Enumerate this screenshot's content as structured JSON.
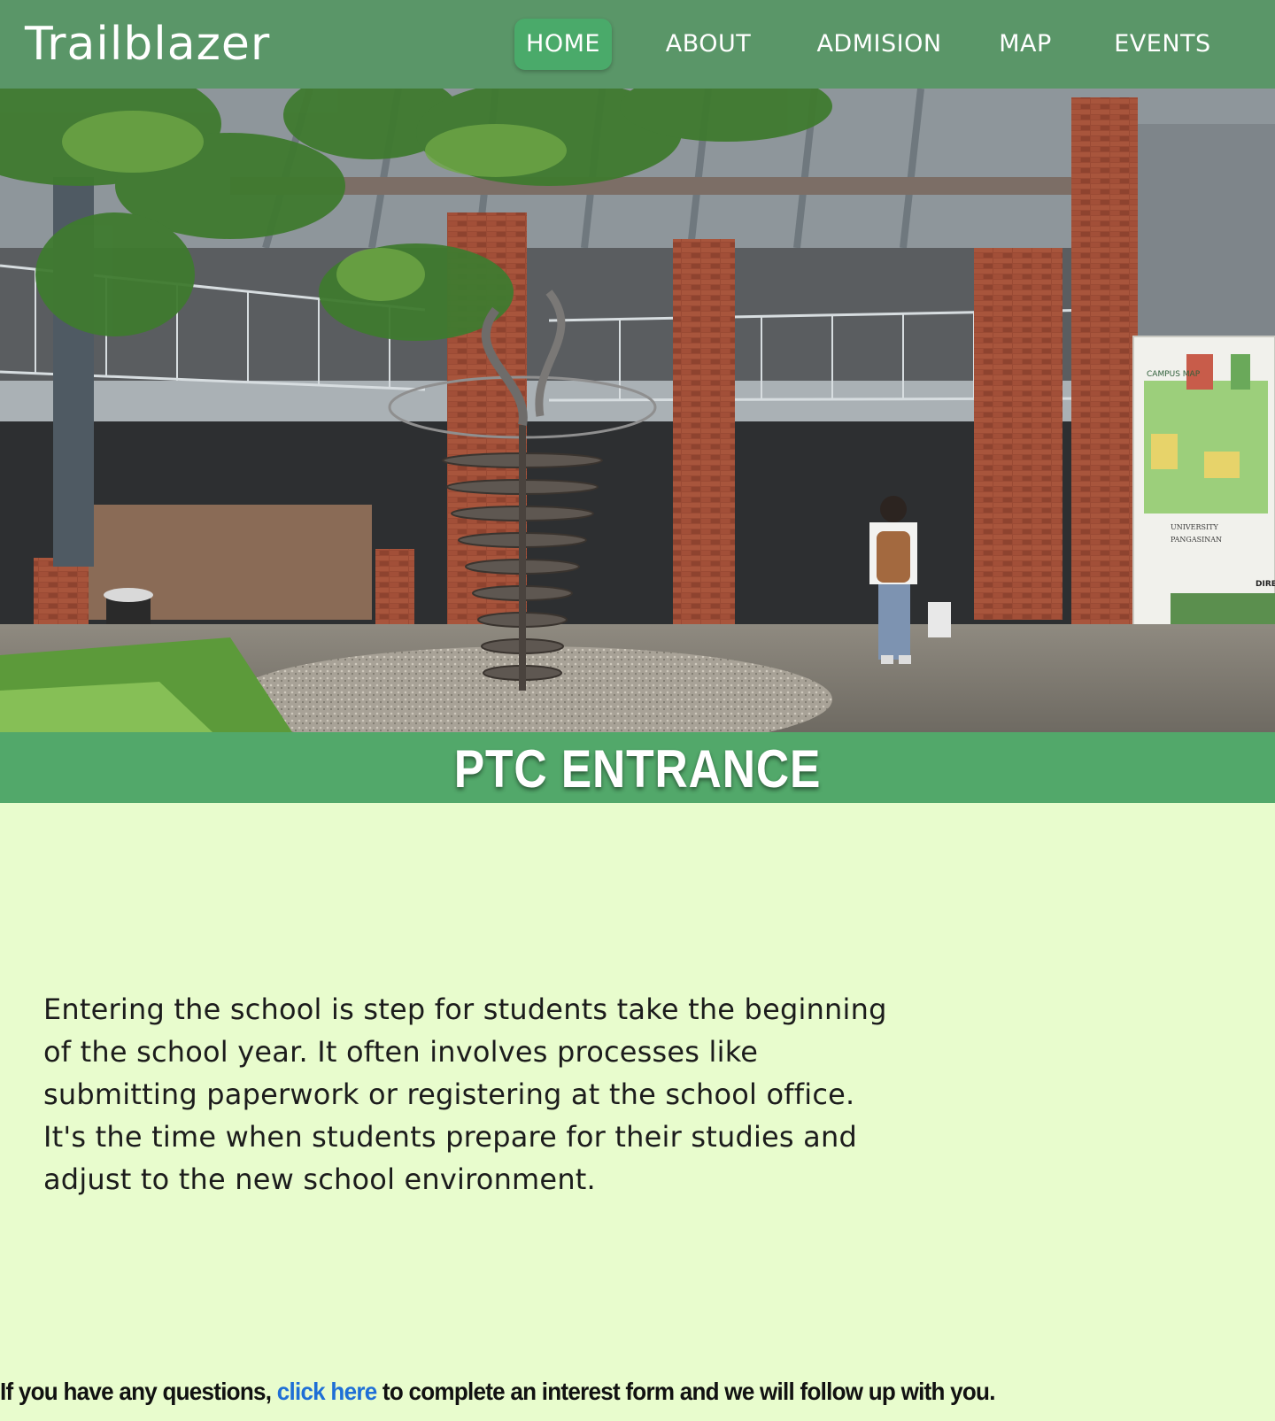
{
  "brand": {
    "name": "Trailblazer"
  },
  "nav": {
    "items": [
      {
        "label": "HOME",
        "active": true
      },
      {
        "label": "ABOUT",
        "active": false
      },
      {
        "label": "ADMISION",
        "active": false
      },
      {
        "label": "MAP",
        "active": false
      },
      {
        "label": "EVENTS",
        "active": false
      }
    ]
  },
  "hero": {
    "image_subject": "school-entrance-photo",
    "sign_text": {
      "campus_map": "CAMPUS MAP",
      "university": "UNIVERSITY",
      "pangasinan": "PANGASINAN",
      "direc": "DIREC"
    }
  },
  "title": "PTC ENTRANCE",
  "description": "Entering the school is step for students take the beginning of the school year. It often involves processes like submitting paperwork or registering at the school office. It's the time when students prepare for their studies and adjust to the new school environment.",
  "footer": {
    "before_link": "If you have any questions, ",
    "link_text": "click here",
    "after_link": " to complete an interest form and we will follow up with you."
  },
  "colors": {
    "navbar": "#5a9668",
    "nav_active": "#4aaa6a",
    "title_band": "#52a86a",
    "page_background": "#e8fccd",
    "link": "#1f6fd6"
  }
}
